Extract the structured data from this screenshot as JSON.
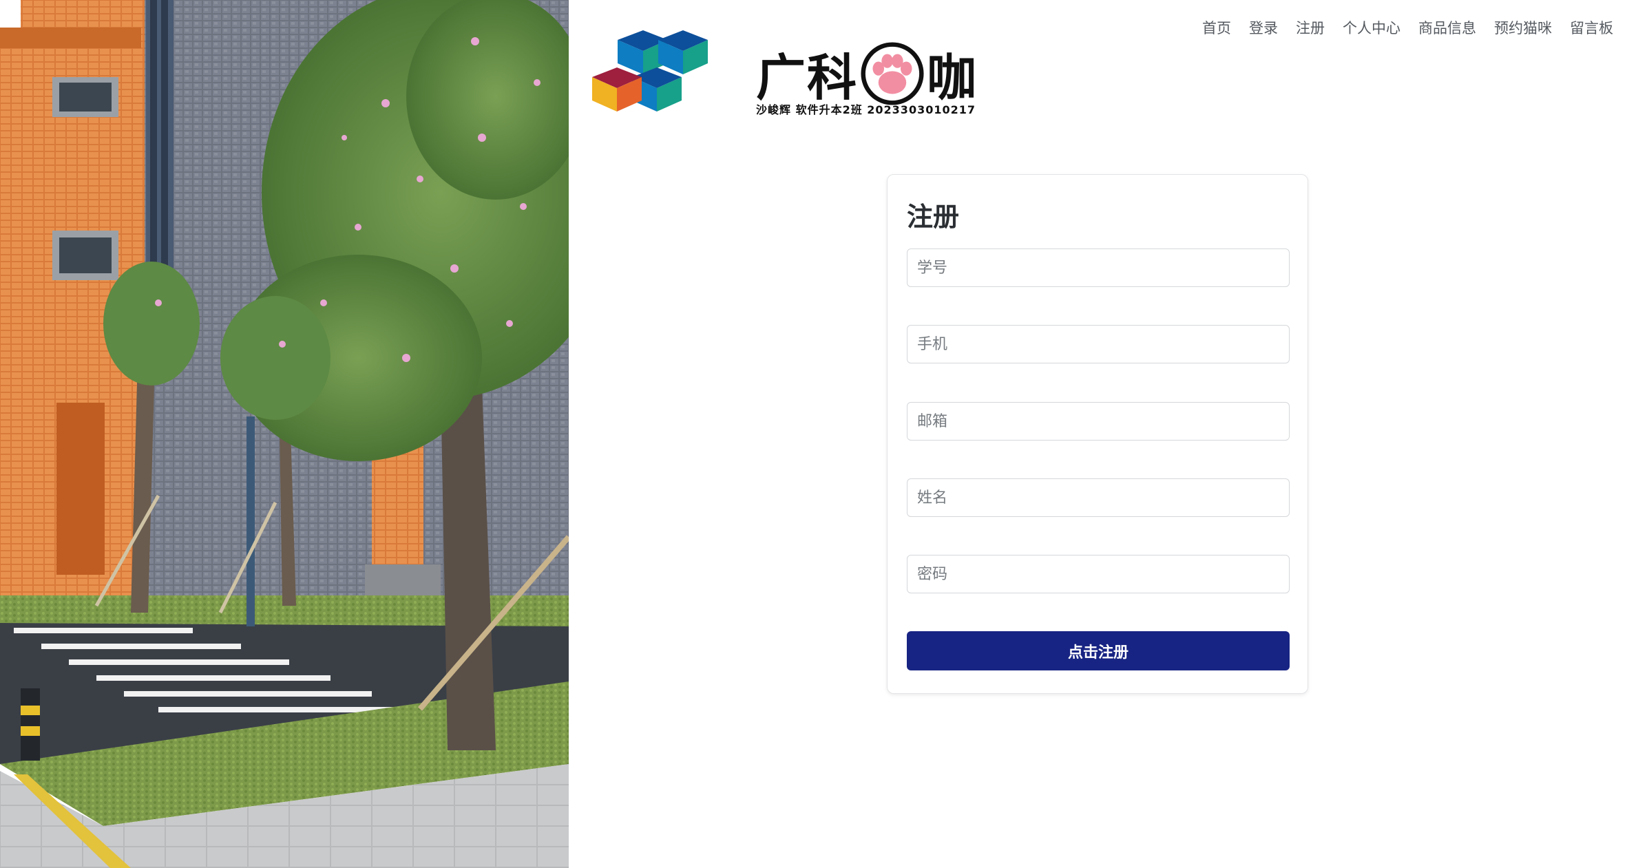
{
  "nav": {
    "items": [
      {
        "label": "首页"
      },
      {
        "label": "登录"
      },
      {
        "label": "注册"
      },
      {
        "label": "个人中心"
      },
      {
        "label": "商品信息"
      },
      {
        "label": "预约猫咪"
      },
      {
        "label": "留言板"
      }
    ]
  },
  "logo": {
    "brand_left": "广科",
    "brand_right": "咖",
    "subtitle": "沙峻辉 软件升本2班 2023303010217",
    "icon": "paw-icon"
  },
  "register": {
    "title": "注册",
    "fields": {
      "student_id": {
        "placeholder": "学号",
        "value": ""
      },
      "phone": {
        "placeholder": "手机",
        "value": ""
      },
      "email": {
        "placeholder": "邮箱",
        "value": ""
      },
      "name": {
        "placeholder": "姓名",
        "value": ""
      },
      "password": {
        "placeholder": "密码",
        "value": ""
      }
    },
    "submit_label": "点击注册"
  },
  "colors": {
    "primary_button": "#182483",
    "nav_text": "#555a60"
  }
}
